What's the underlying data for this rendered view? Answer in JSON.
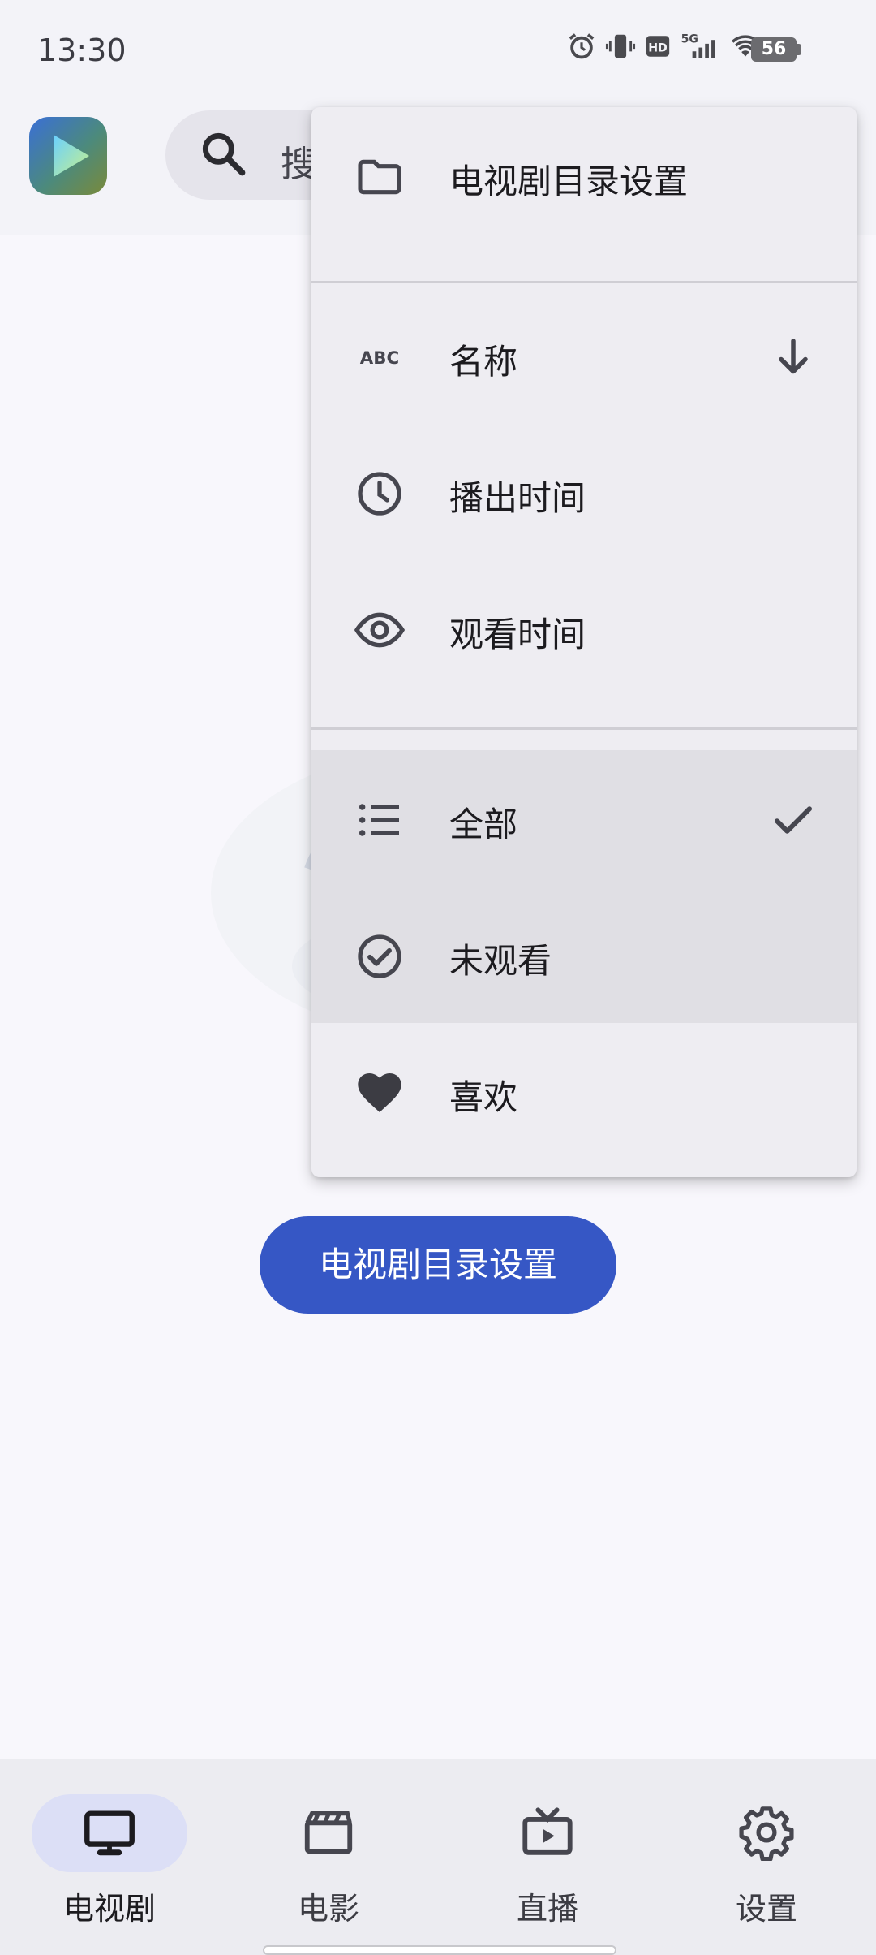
{
  "status_bar": {
    "time": "13:30",
    "battery": "56",
    "network": "5G",
    "hd": "HD"
  },
  "header": {
    "search_placeholder": "搜"
  },
  "menu": {
    "items": [
      {
        "label": "电视剧目录设置",
        "icon": "folder-icon"
      },
      {
        "label": "名称",
        "icon": "abc-icon",
        "trailing": "arrow-down-icon"
      },
      {
        "label": "播出时间",
        "icon": "clock-icon"
      },
      {
        "label": "观看时间",
        "icon": "eye-icon"
      },
      {
        "label": "全部",
        "icon": "list-icon",
        "trailing": "check-icon",
        "selected": true
      },
      {
        "label": "未观看",
        "icon": "check-circle-icon",
        "selected": true
      },
      {
        "label": "喜欢",
        "icon": "heart-icon"
      }
    ]
  },
  "main": {
    "button_label": "电视剧目录设置"
  },
  "bottom_nav": {
    "items": [
      {
        "label": "电视剧",
        "icon": "tv-icon",
        "active": true
      },
      {
        "label": "电影",
        "icon": "movie-icon"
      },
      {
        "label": "直播",
        "icon": "live-tv-icon"
      },
      {
        "label": "设置",
        "icon": "gear-icon"
      }
    ]
  },
  "colors": {
    "accent": "#3657c5",
    "active_pill": "#dcdff6",
    "menu_bg": "#eeedf2",
    "menu_selected": "#e0dfe4"
  }
}
